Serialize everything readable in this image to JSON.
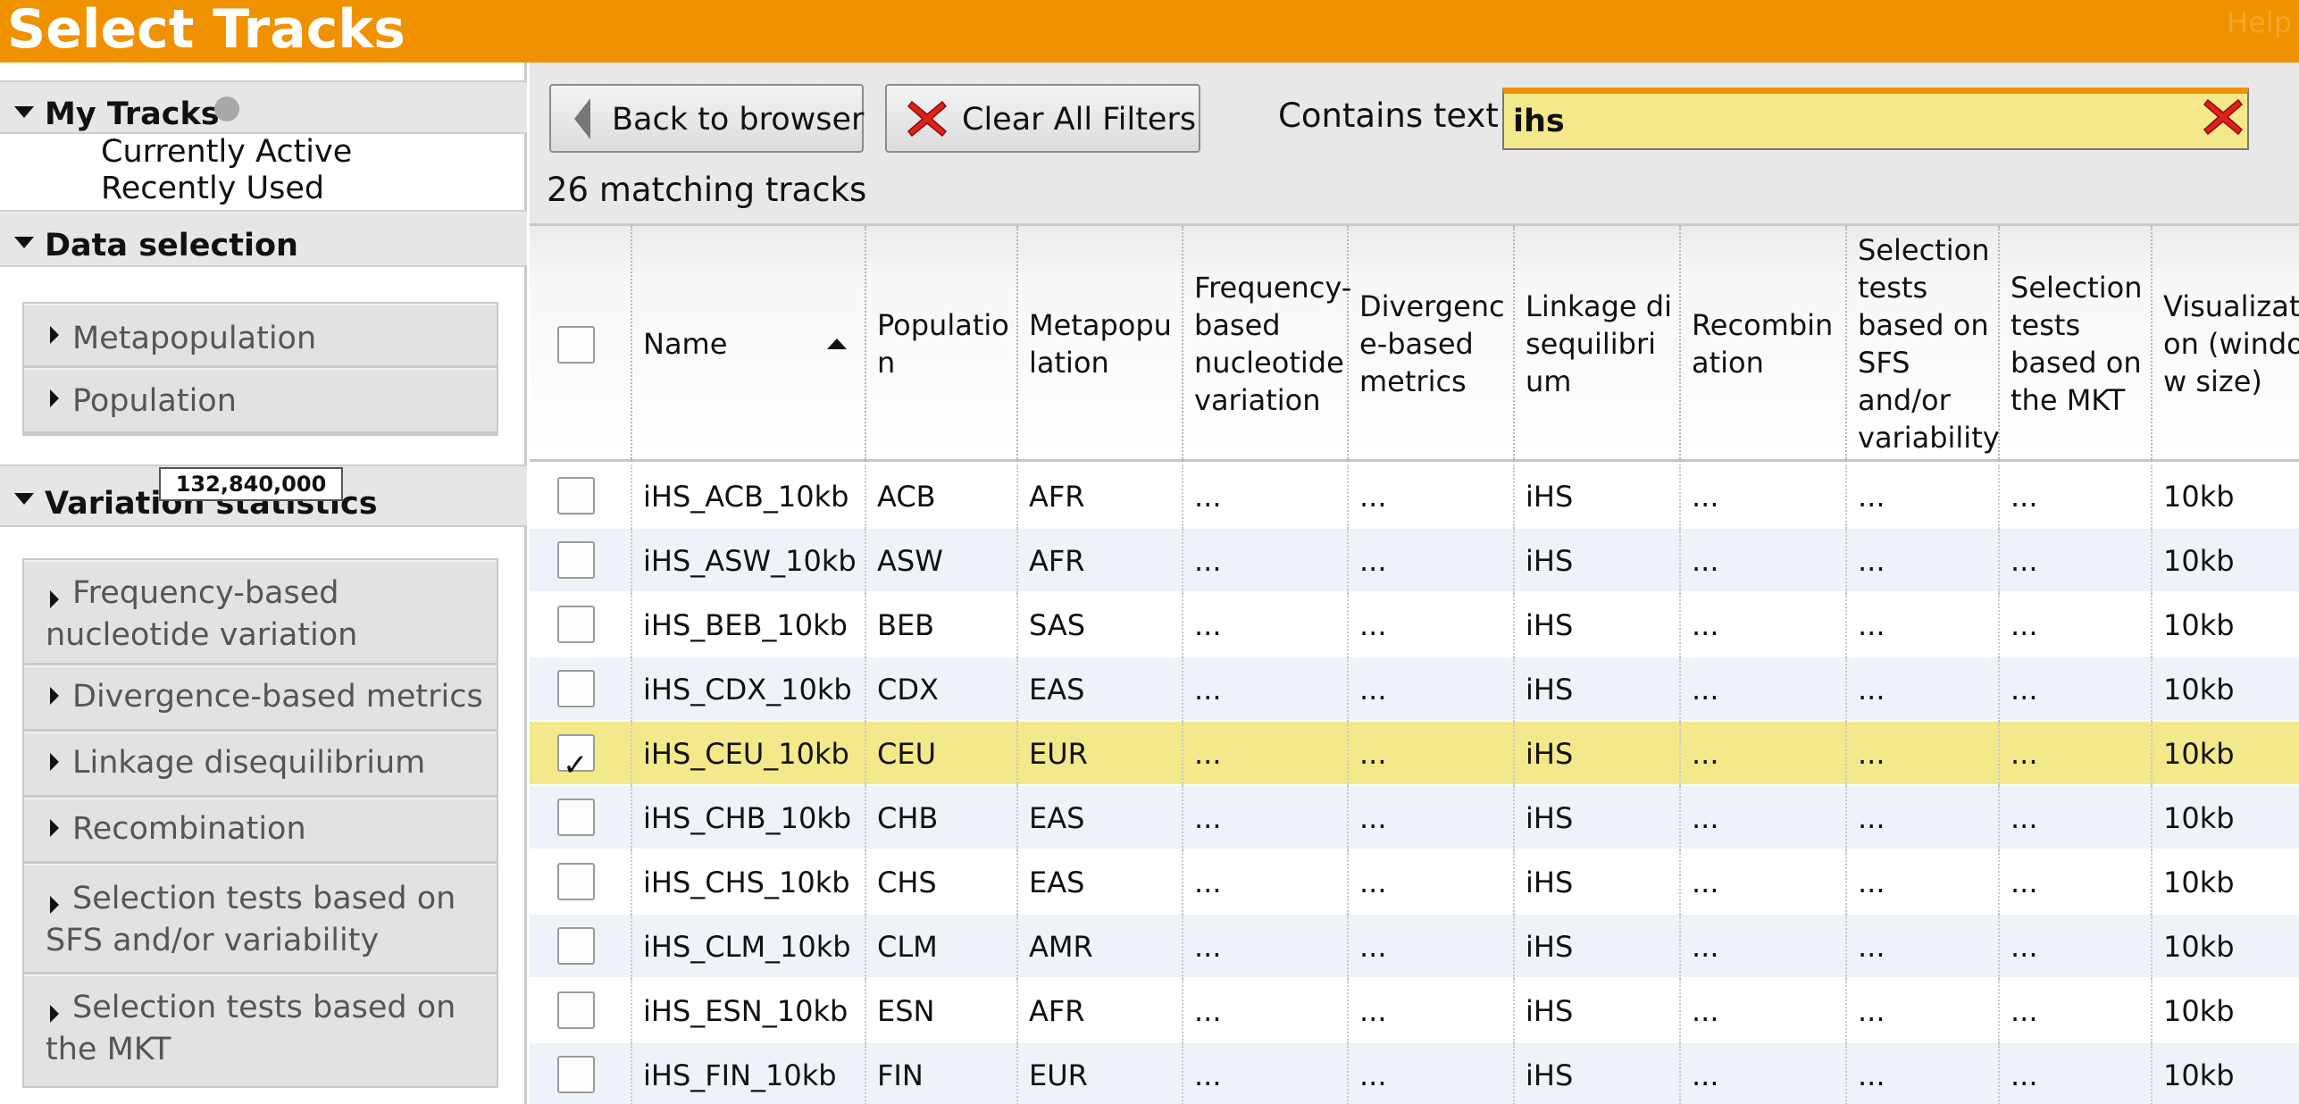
{
  "header": {
    "title": "Select Tracks",
    "help": "Help"
  },
  "sidebar": {
    "my_tracks": {
      "title": "My Tracks",
      "items": [
        "Currently Active",
        "Recently Used"
      ]
    },
    "data_selection": {
      "title": "Data selection",
      "facets": [
        "Metapopulation",
        "Population"
      ]
    },
    "tooltip": "132,840,000",
    "variation_statistics": {
      "title": "Variation statistics",
      "facets": [
        "Frequency-based nucleotide variation",
        "Divergence-based metrics",
        "Linkage disequilibrium",
        "Recombination",
        "Selection tests based on SFS and/or variability",
        "Selection tests based on the MKT"
      ]
    }
  },
  "toolbar": {
    "back_label": "Back to browser",
    "clear_label": "Clear All Filters",
    "contains_label": "Contains text",
    "search_value": "ihs",
    "match_count": "26 matching tracks"
  },
  "table": {
    "columns": [
      "Name",
      "Population",
      "Metapopulation",
      "Frequency-based nucleotide variation",
      "Divergence-based metrics",
      "Linkage disequilibrium",
      "Recombination",
      "Selection tests based on SFS and/or variability",
      "Selection tests based on the MKT",
      "Visualization (window size)"
    ],
    "rows": [
      {
        "checked": false,
        "cells": [
          "iHS_ACB_10kb",
          "ACB",
          "AFR",
          "...",
          "...",
          "iHS",
          "...",
          "...",
          "...",
          "10kb"
        ]
      },
      {
        "checked": false,
        "cells": [
          "iHS_ASW_10kb",
          "ASW",
          "AFR",
          "...",
          "...",
          "iHS",
          "...",
          "...",
          "...",
          "10kb"
        ]
      },
      {
        "checked": false,
        "cells": [
          "iHS_BEB_10kb",
          "BEB",
          "SAS",
          "...",
          "...",
          "iHS",
          "...",
          "...",
          "...",
          "10kb"
        ]
      },
      {
        "checked": false,
        "cells": [
          "iHS_CDX_10kb",
          "CDX",
          "EAS",
          "...",
          "...",
          "iHS",
          "...",
          "...",
          "...",
          "10kb"
        ]
      },
      {
        "checked": true,
        "cells": [
          "iHS_CEU_10kb",
          "CEU",
          "EUR",
          "...",
          "...",
          "iHS",
          "...",
          "...",
          "...",
          "10kb"
        ]
      },
      {
        "checked": false,
        "cells": [
          "iHS_CHB_10kb",
          "CHB",
          "EAS",
          "...",
          "...",
          "iHS",
          "...",
          "...",
          "...",
          "10kb"
        ]
      },
      {
        "checked": false,
        "cells": [
          "iHS_CHS_10kb",
          "CHS",
          "EAS",
          "...",
          "...",
          "iHS",
          "...",
          "...",
          "...",
          "10kb"
        ]
      },
      {
        "checked": false,
        "cells": [
          "iHS_CLM_10kb",
          "CLM",
          "AMR",
          "...",
          "...",
          "iHS",
          "...",
          "...",
          "...",
          "10kb"
        ]
      },
      {
        "checked": false,
        "cells": [
          "iHS_ESN_10kb",
          "ESN",
          "AFR",
          "...",
          "...",
          "iHS",
          "...",
          "...",
          "...",
          "10kb"
        ]
      },
      {
        "checked": false,
        "cells": [
          "iHS_FIN_10kb",
          "FIN",
          "EUR",
          "...",
          "...",
          "iHS",
          "...",
          "...",
          "...",
          "10kb"
        ]
      }
    ]
  },
  "colors": {
    "header": "#f09200",
    "selected_row": "#f3e98a",
    "alt_row": "#eef3f9",
    "clear_icon": "#e0201b"
  }
}
